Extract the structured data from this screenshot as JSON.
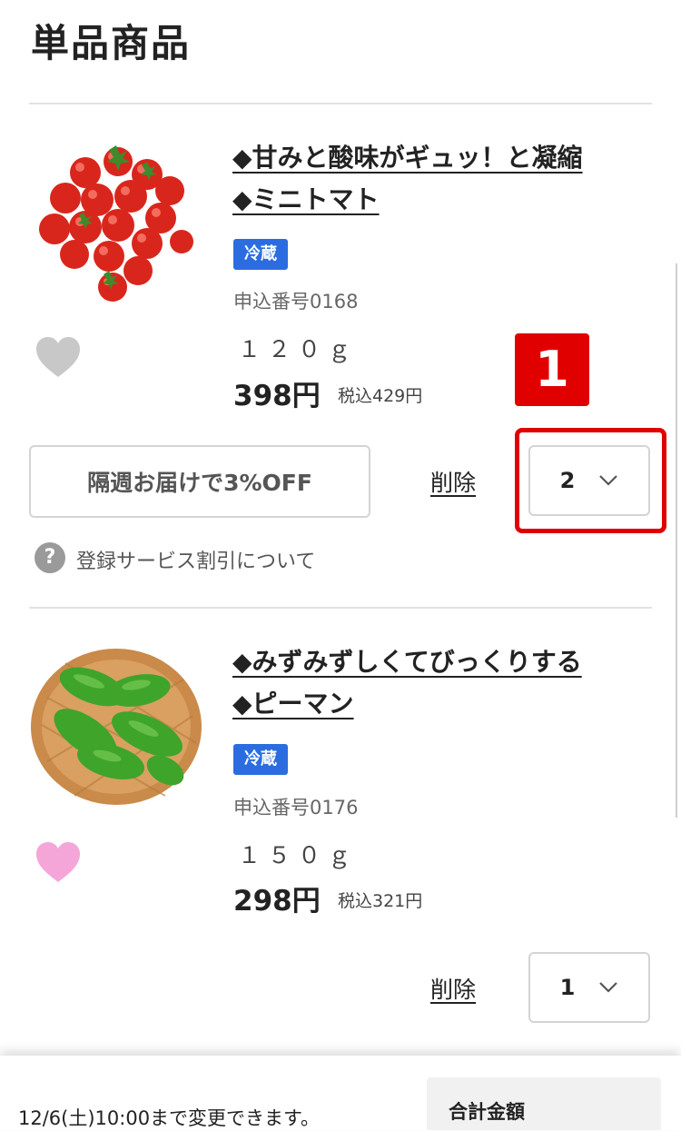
{
  "section_title": "単品商品",
  "products": [
    {
      "name_line1": "◆甘みと酸味がギュッ！と凝縮",
      "name_line2": "◆ミニトマト",
      "storage": "冷蔵",
      "code": "申込番号0168",
      "weight": "１２０ｇ",
      "price": "398円",
      "price_tax_included": "税込429円",
      "favorited": false,
      "subscription_button": "隔週お届けで3%OFF",
      "help_text": "登録サービス割引について",
      "delete_label": "削除",
      "quantity": "2"
    },
    {
      "name_line1": "◆みずみずしくてびっくりする",
      "name_line2": "◆ピーマン",
      "storage": "冷蔵",
      "code": "申込番号0176",
      "weight": "１５０ｇ",
      "price": "298円",
      "price_tax_included": "税込321円",
      "favorited": true,
      "delete_label": "削除",
      "quantity": "1"
    }
  ],
  "annotation": {
    "number": "1",
    "color": "#e00000"
  },
  "footer": {
    "deadline_note": "12/6(土)10:00まで変更できます。",
    "total_label": "合計金額"
  },
  "colors": {
    "badge": "#2b6de0",
    "heart_off": "#c8c8c8",
    "heart_on": "#f4a6d9"
  }
}
